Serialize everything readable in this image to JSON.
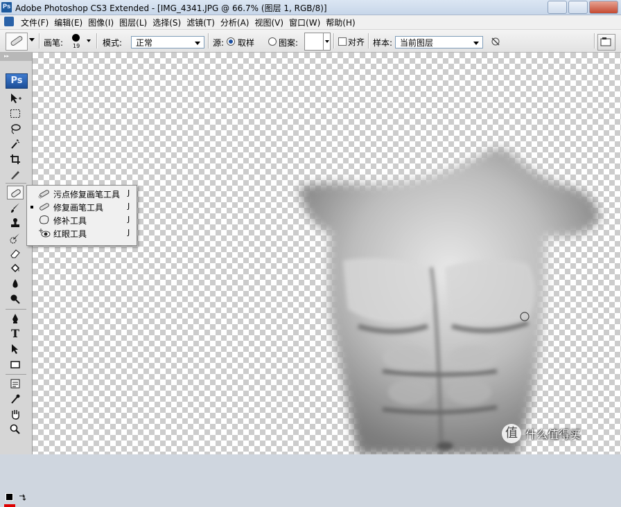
{
  "window": {
    "title": "Adobe Photoshop CS3 Extended - [IMG_4341.JPG @ 66.7% (图层 1, RGB/8)]",
    "app_icon": "Ps"
  },
  "menu": {
    "items": [
      "文件(F)",
      "编辑(E)",
      "图像(I)",
      "图层(L)",
      "选择(S)",
      "滤镜(T)",
      "分析(A)",
      "视图(V)",
      "窗口(W)",
      "帮助(H)"
    ]
  },
  "options": {
    "brush_label": "画笔:",
    "brush_size": "19",
    "mode_label": "模式:",
    "mode_value": "正常",
    "source_label": "源:",
    "sampled_label": "取样",
    "sampled_selected": true,
    "pattern_label": "图案:",
    "aligned_label": "对齐",
    "aligned_checked": false,
    "sample_label": "样本:",
    "sample_value": "当前图层"
  },
  "toolbox": {
    "logo": "Ps",
    "tools": [
      "move-tool",
      "marquee-tool",
      "lasso-tool",
      "magic-wand-tool",
      "crop-tool",
      "slice-tool",
      "healing-brush-tool",
      "brush-tool",
      "clone-stamp-tool",
      "history-brush-tool",
      "eraser-tool",
      "paint-bucket-tool",
      "blur-tool",
      "dodge-tool",
      "pen-tool",
      "type-tool",
      "path-selection-tool",
      "rectangle-tool",
      "notes-tool",
      "eyedropper-tool",
      "hand-tool",
      "zoom-tool"
    ],
    "active_tool": "healing-brush-tool",
    "type_glyph": "T"
  },
  "flyout": {
    "items": [
      {
        "label": "污点修复画笔工具",
        "shortcut": "J",
        "selected": false,
        "icon": "spot-healing-brush-icon"
      },
      {
        "label": "修复画笔工具",
        "shortcut": "J",
        "selected": true,
        "icon": "healing-brush-icon"
      },
      {
        "label": "修补工具",
        "shortcut": "J",
        "selected": false,
        "icon": "patch-icon"
      },
      {
        "label": "红眼工具",
        "shortcut": "J",
        "selected": false,
        "icon": "red-eye-icon"
      }
    ]
  },
  "watermark": {
    "glyph": "值",
    "text": "什么值得买"
  },
  "colors": {
    "accent": "#1d5a9e",
    "checker": "#cccccc"
  }
}
